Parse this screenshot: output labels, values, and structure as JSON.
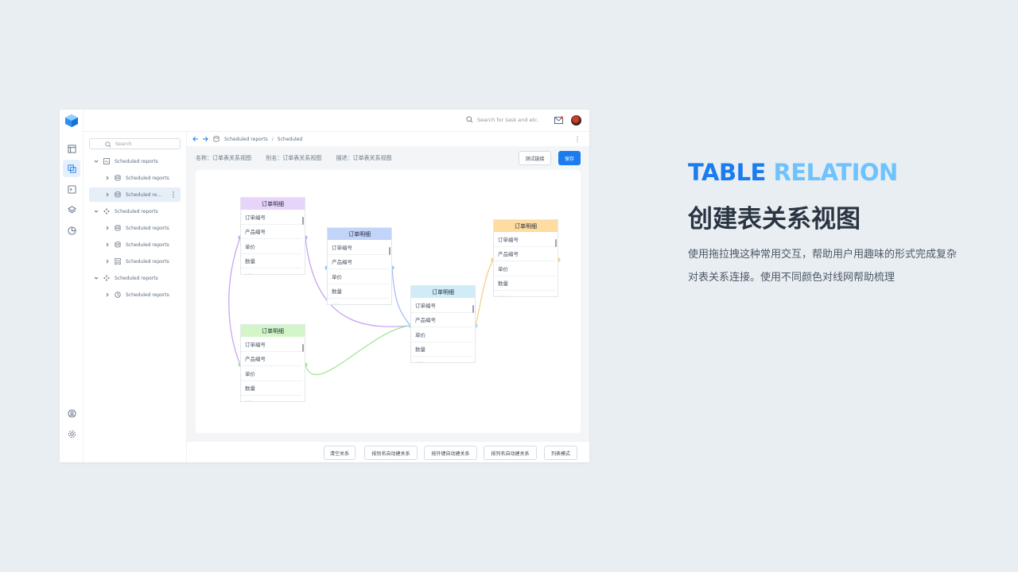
{
  "topbar": {
    "search_placeholder": "Search for task and etc."
  },
  "tree": {
    "search_placeholder": "Search",
    "items": [
      {
        "label": "Scheduled reports"
      },
      {
        "label": "Scheduled reports"
      },
      {
        "label": "Scheduled re..."
      },
      {
        "label": "Scheduled reports"
      },
      {
        "label": "Scheduled reports"
      },
      {
        "label": "Scheduled reports"
      },
      {
        "label": "Scheduled reports"
      },
      {
        "label": "Scheduled reports"
      },
      {
        "label": "Scheduled reports"
      }
    ]
  },
  "breadcrumb": {
    "item1": "Scheduled reports",
    "separator": "/",
    "item2": "Scheduled"
  },
  "meta": {
    "name": "名称：订单表关系视图",
    "alias": "别名：订单表关系视图",
    "desc": "描述：订单表关系视图"
  },
  "buttons": {
    "test": "测试链接",
    "save": "保存"
  },
  "tables": [
    {
      "title": "订单明细",
      "header_color": "#e6d4fb",
      "rows": [
        "订单编号",
        "产品编号",
        "单价",
        "数量",
        "折扣"
      ]
    },
    {
      "title": "订单明细",
      "header_color": "#c2d4fa",
      "rows": [
        "订单编号",
        "产品编号",
        "单价",
        "数量",
        "折扣"
      ]
    },
    {
      "title": "订单明细",
      "header_color": "#ffdca0",
      "rows": [
        "订单编号",
        "产品编号",
        "单价",
        "数量",
        "折扣"
      ]
    },
    {
      "title": "订单明细",
      "header_color": "#d0ecf8",
      "rows": [
        "订单编号",
        "产品编号",
        "单价",
        "数量",
        "折扣"
      ]
    },
    {
      "title": "订单明细",
      "header_color": "#d2f6c8",
      "rows": [
        "订单编号",
        "产品编号",
        "单价",
        "数量",
        "折扣"
      ]
    }
  ],
  "link_colors": {
    "purple": "#c7a6f2",
    "blue": "#9ec2f6",
    "orange": "#f7cf8a",
    "green": "#a7e49a",
    "cyan": "#a9dcef"
  },
  "bottom_buttons": [
    "清空关系",
    "按别名自动建关系",
    "按外键自动建关系",
    "按列名自动建关系",
    "列表模式"
  ],
  "promo": {
    "title_en_a": "TABLE",
    "title_en_b": "RELATION",
    "title_cn": "创建表关系视图",
    "desc_line1": "使用拖拉拽这种常用交互，帮助用户用趣味的形式完成复杂",
    "desc_line2": "对表关系连接。使用不同颜色对线网帮助梳理"
  },
  "colors": {
    "accent": "#1b7cf0",
    "accent_light": "#6ec3ff"
  }
}
